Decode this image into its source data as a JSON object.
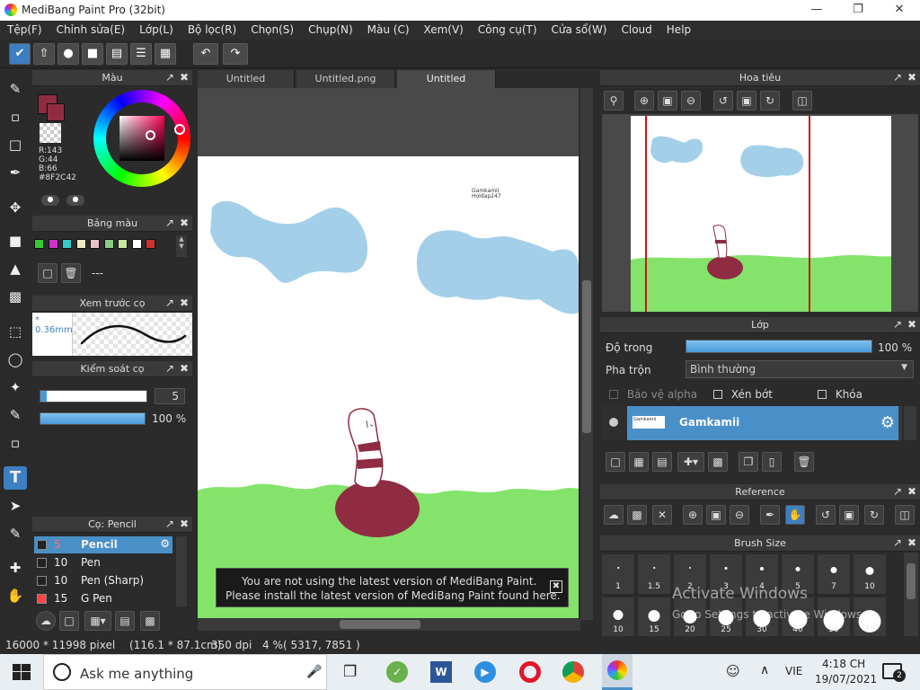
{
  "app": {
    "title": "MediBang Paint Pro (32bit)"
  },
  "menu": [
    "Tệp(F)",
    "Chỉnh sửa(E)",
    "Lớp(L)",
    "Bộ lọc(R)",
    "Chọn(S)",
    "Chụp(N)",
    "Màu (C)",
    "Xem(V)",
    "Công cụ(T)",
    "Cửa sổ(W)",
    "Cloud",
    "Help"
  ],
  "tabs": [
    "Untitled",
    "Untitled.png",
    "Untitled"
  ],
  "color_panel": {
    "title": "Màu",
    "r": "R:143",
    "g": "G:44",
    "b": "B:66",
    "hex": "#8F2C42",
    "current_color": "#8F2C42"
  },
  "palette_panel": {
    "title": "Bảng màu",
    "swatches": [
      "#33cc33",
      "#cc33cc",
      "#33cccc",
      "#f0e8c0",
      "#e8c0c8",
      "#88cc88",
      "#c8e8a0",
      "#ffffff",
      "#cc3333"
    ],
    "name": "---"
  },
  "brush_preview": {
    "title": "Xem trước cọ",
    "size": "* 0.36mm"
  },
  "brush_control": {
    "title": "Kiểm soát cọ",
    "size": "5",
    "opacity": "100 %"
  },
  "brush_list": {
    "title": "Cọ: Pencil",
    "items": [
      {
        "size": "5",
        "name": "Pencil",
        "color": "#222222"
      },
      {
        "size": "10",
        "name": "Pen",
        "color": "#222222"
      },
      {
        "size": "10",
        "name": "Pen (Sharp)",
        "color": "#222222"
      },
      {
        "size": "15",
        "name": "G Pen",
        "color": "#ff4444"
      }
    ]
  },
  "canvas": {
    "watermark_line1": "Gamkamii",
    "watermark_line2": "Holdap247"
  },
  "notice": {
    "line1": "You are not using the latest version of MediBang Paint.",
    "line2": "Please install the latest version of MediBang Paint found here."
  },
  "navigator": {
    "title": "Hoa tiêu"
  },
  "layer_panel": {
    "title": "Lớp",
    "opacity_label": "Độ trong",
    "opacity_value": "100 %",
    "blend_label": "Pha trộn",
    "blend_value": "Bình thường",
    "alpha_protect": "Bảo vệ alpha",
    "clipping": "Xén bớt",
    "lock": "Khóa",
    "layer_name": "Gamkamii",
    "thumb_text": "Gamkamii"
  },
  "reference": {
    "title": "Reference"
  },
  "brush_size": {
    "title": "Brush Size",
    "row1": [
      "1",
      "1.5",
      "2",
      "3",
      "4",
      "5",
      "7",
      "10"
    ],
    "row2": [
      "10",
      "15",
      "20",
      "25",
      "30",
      "40",
      "50",
      "70"
    ]
  },
  "watermark": {
    "line1": "Activate Windows",
    "line2": "Go to Settings to activate Windows."
  },
  "status": {
    "dims": "16000 * 11998 pixel",
    "mm": "(116.1 * 87.1cm)",
    "dpi": "350 dpi",
    "zoom": "4 %",
    "coords": "( 5317, 7851 )"
  },
  "taskbar": {
    "search_placeholder": "Ask me anything",
    "lang": "VIE",
    "time": "4:18 CH",
    "date": "19/07/2021",
    "notifications": "2"
  }
}
